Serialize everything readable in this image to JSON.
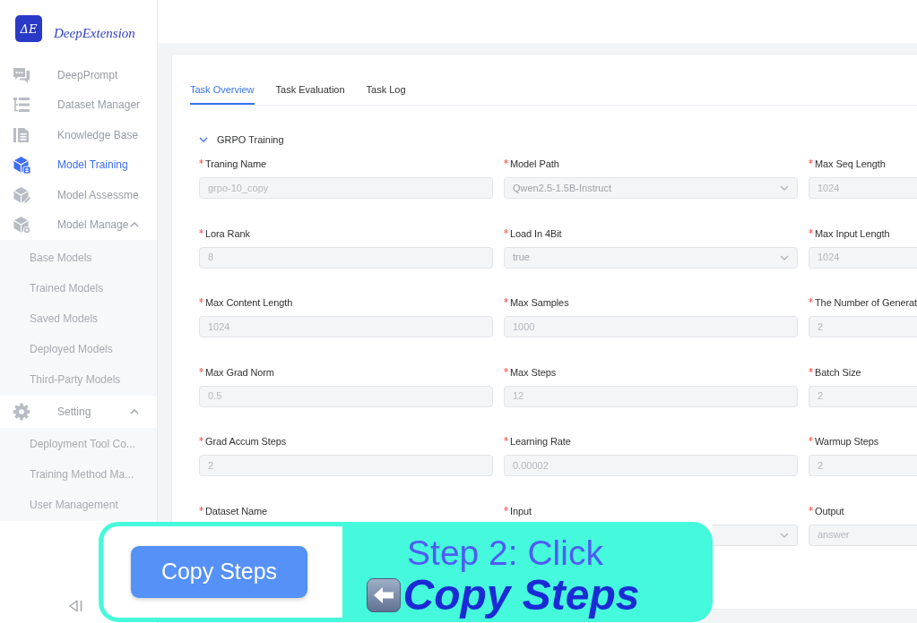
{
  "sidebar": {
    "logo_mark": "ΔE",
    "brand": "DeepExtension",
    "items": [
      {
        "label": "DeepPrompt",
        "selected": false
      },
      {
        "label": "Dataset Manager",
        "selected": false
      },
      {
        "label": "Knowledge Base",
        "selected": false
      },
      {
        "label": "Model Training",
        "selected": true
      },
      {
        "label": "Model Assessme",
        "selected": false
      },
      {
        "label": "Model Manage",
        "selected": false,
        "expanded": true,
        "children": [
          {
            "label": "Base Models",
            "selected": false
          },
          {
            "label": "Trained Models",
            "selected": false
          },
          {
            "label": "Saved Models",
            "selected": false
          },
          {
            "label": "Deployed Models",
            "selected": false
          },
          {
            "label": "Third-Party Models",
            "selected": false
          }
        ]
      },
      {
        "label": "Setting",
        "selected": false,
        "expanded": true,
        "children": [
          {
            "label": "Deployment Tool Co...",
            "selected": false
          },
          {
            "label": "Training Method Ma...",
            "selected": false
          },
          {
            "label": "User Management",
            "selected": false
          }
        ]
      }
    ]
  },
  "tabs": [
    {
      "label": "Task Overview",
      "selected": true
    },
    {
      "label": "Task Evaluation",
      "selected": false
    },
    {
      "label": "Task Log",
      "selected": false
    }
  ],
  "section": {
    "title": "GRPO Training",
    "expanded": true,
    "fields": [
      {
        "label": "Traning Name",
        "required": true,
        "kind": "input",
        "disabled": true,
        "value": "grpo-10_copy"
      },
      {
        "label": "Model Path",
        "required": true,
        "kind": "select",
        "disabled": true,
        "value": "Qwen2.5-1.5B-Instruct"
      },
      {
        "label": "Max Seq Length",
        "required": true,
        "kind": "input",
        "disabled": true,
        "value": "1024"
      },
      {
        "label": "Lora Rank",
        "required": true,
        "kind": "input",
        "disabled": true,
        "value": "8"
      },
      {
        "label": "Load In 4Bit",
        "required": true,
        "kind": "select",
        "disabled": true,
        "value": "true"
      },
      {
        "label": "Max Input Length",
        "required": true,
        "kind": "input",
        "disabled": true,
        "value": "1024"
      },
      {
        "label": "Max Content Length",
        "required": true,
        "kind": "input",
        "disabled": true,
        "value": "1024"
      },
      {
        "label": "Max Samples",
        "required": true,
        "kind": "input",
        "disabled": true,
        "value": "1000"
      },
      {
        "label": "The Number of Generat",
        "required": true,
        "kind": "input",
        "disabled": true,
        "value": "2"
      },
      {
        "label": "Max Grad Norm",
        "required": true,
        "kind": "input",
        "disabled": true,
        "value": "0.5"
      },
      {
        "label": "Max Steps",
        "required": true,
        "kind": "input",
        "disabled": true,
        "value": "12"
      },
      {
        "label": "Batch Size",
        "required": true,
        "kind": "input",
        "disabled": true,
        "value": "2"
      },
      {
        "label": "Grad Accum Steps",
        "required": true,
        "kind": "input",
        "disabled": true,
        "value": "2"
      },
      {
        "label": "Learning Rate",
        "required": true,
        "kind": "input",
        "disabled": true,
        "value": "0.00002"
      },
      {
        "label": "Warmup Steps",
        "required": true,
        "kind": "input",
        "disabled": true,
        "value": "2"
      },
      {
        "label": "Dataset Name",
        "required": true
      },
      {
        "label": "Input",
        "required": true,
        "kind": "select",
        "disabled": true
      },
      {
        "label": "Output",
        "required": true,
        "kind": "input",
        "disabled": true,
        "value": "answer"
      }
    ]
  },
  "callout": {
    "button": "Copy Steps",
    "title": "Step 2: Click",
    "action": "Copy Steps"
  }
}
